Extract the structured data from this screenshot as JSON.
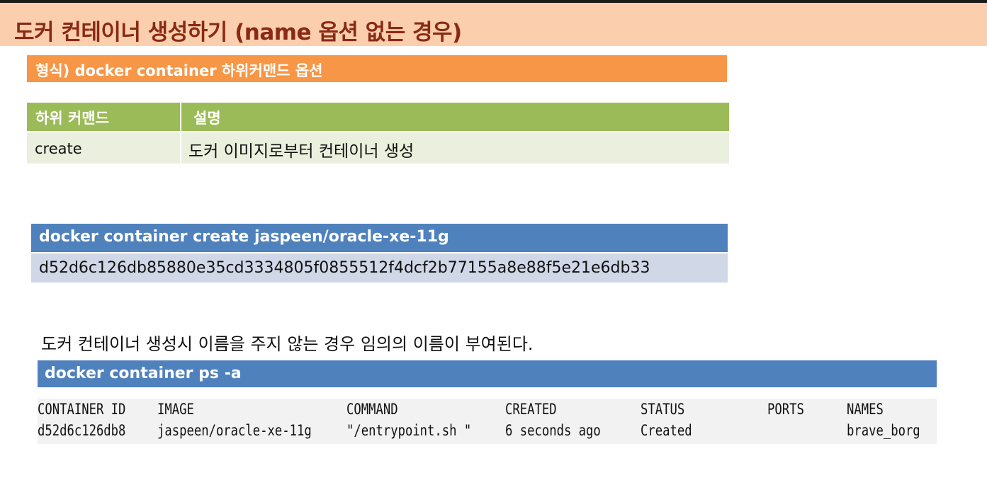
{
  "title": "도커 컨테이너 생성하기 (name 옵션 없는 경우)",
  "format_line": "형식) docker container 하위커맨드 옵션",
  "subcommand_table": {
    "headers": [
      "하위 커맨드",
      "설명"
    ],
    "rows": [
      [
        "create",
        "도커 이미지로부터 컨테이너 생성"
      ]
    ]
  },
  "create_example": {
    "command": "docker container create jaspeen/oracle-xe-11g",
    "output": "d52d6c126db85880e35cd3334805f0855512f4dcf2b77155a8e88f5e21e6db33"
  },
  "note": "도커 컨테이너 생성시 이름을 주지 않는 경우 임의의 이름이 부여된다.",
  "ps_example": {
    "command": "docker container ps -a",
    "columns": [
      "CONTAINER ID",
      "IMAGE",
      "COMMAND",
      "CREATED",
      "STATUS",
      "PORTS",
      "NAMES"
    ],
    "row": [
      "d52d6c126db8",
      "jaspeen/oracle-xe-11g",
      "\"/entrypoint.sh \"",
      "6 seconds ago",
      "Created",
      "",
      "brave_borg"
    ]
  },
  "colors": {
    "title_bg": "#fbcfae",
    "title_text": "#8a2a14",
    "format_bg": "#f79646",
    "table_head": "#9bbb59",
    "table_row": "#eaf0dd",
    "code_head": "#4f81bd",
    "code_out": "#d0d8e8"
  }
}
